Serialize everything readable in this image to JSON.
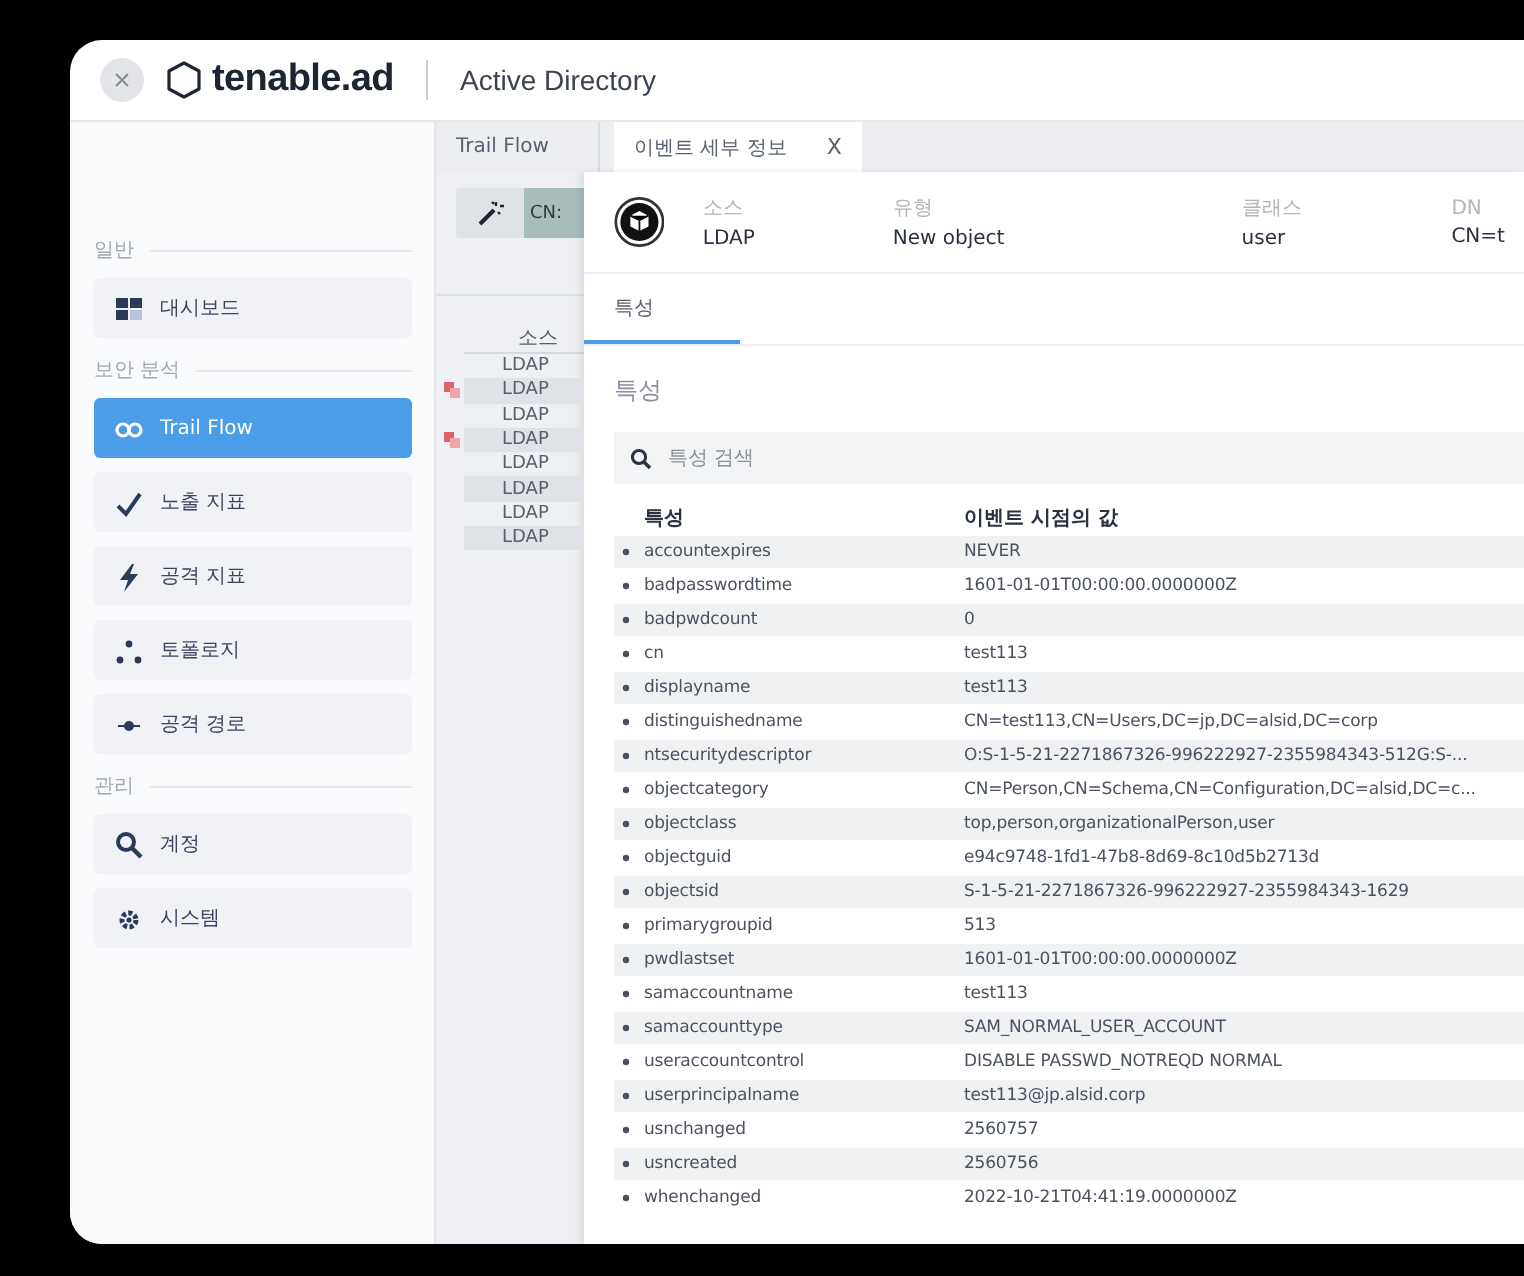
{
  "header": {
    "close_label": "×",
    "logo": "tenable.ad",
    "product": "Active Directory"
  },
  "sidebar": {
    "sections": [
      {
        "label": "일반",
        "items": [
          {
            "label": "대시보드",
            "kind": "dashboard",
            "selected": false
          }
        ]
      },
      {
        "label": "보안 분석",
        "items": [
          {
            "label": "Trail Flow",
            "kind": "flow",
            "selected": true
          },
          {
            "label": "노출 지표",
            "kind": "check",
            "selected": false
          },
          {
            "label": "공격 지표",
            "kind": "bolt",
            "selected": false
          },
          {
            "label": "토폴로지",
            "kind": "topology",
            "selected": false
          },
          {
            "label": "공격 경로",
            "kind": "path",
            "selected": false
          }
        ]
      },
      {
        "label": "관리",
        "items": [
          {
            "label": "계정",
            "kind": "search",
            "selected": false
          },
          {
            "label": "시스템",
            "kind": "gear",
            "selected": false
          }
        ]
      }
    ]
  },
  "tabs": [
    {
      "label": "Trail Flow",
      "selected": false
    },
    {
      "label": "이벤트 세부 정보",
      "selected": true,
      "close": "X"
    }
  ],
  "trail_flow": {
    "chip": "CN:",
    "column": "소스",
    "rows": [
      {
        "source": "LDAP",
        "flagged": false
      },
      {
        "source": "LDAP",
        "flagged": true
      },
      {
        "source": "LDAP",
        "flagged": false
      },
      {
        "source": "LDAP",
        "flagged": true
      },
      {
        "source": "LDAP",
        "flagged": false
      },
      {
        "source": "LDAP",
        "flagged": false
      },
      {
        "source": "LDAP",
        "flagged": false
      },
      {
        "source": "LDAP",
        "flagged": false
      }
    ]
  },
  "event": {
    "summary": [
      {
        "label": "소스",
        "value": "LDAP"
      },
      {
        "label": "유형",
        "value": "New object"
      },
      {
        "label": "클래스",
        "value": "user"
      },
      {
        "label": "DN",
        "value": "CN=t"
      }
    ],
    "subtabs": [
      {
        "label": "특성",
        "selected": true
      }
    ],
    "heading": "특성",
    "search": {
      "placeholder": "특성 검색"
    },
    "columns": [
      "특성",
      "이벤트 시점의 값"
    ],
    "rows": [
      {
        "attribute": "accountexpires",
        "value": "NEVER"
      },
      {
        "attribute": "badpasswordtime",
        "value": "1601-01-01T00:00:00.0000000Z"
      },
      {
        "attribute": "badpwdcount",
        "value": "0"
      },
      {
        "attribute": "cn",
        "value": "test113"
      },
      {
        "attribute": "displayname",
        "value": "test113"
      },
      {
        "attribute": "distinguishedname",
        "value": "CN=test113,CN=Users,DC=jp,DC=alsid,DC=corp"
      },
      {
        "attribute": "ntsecuritydescriptor",
        "value": "O:S-1-5-21-2271867326-996222927-2355984343-512G:S-..."
      },
      {
        "attribute": "objectcategory",
        "value": "CN=Person,CN=Schema,CN=Configuration,DC=alsid,DC=c..."
      },
      {
        "attribute": "objectclass",
        "value": "top,person,organizationalPerson,user"
      },
      {
        "attribute": "objectguid",
        "value": "e94c9748-1fd1-47b8-8d69-8c10d5b2713d"
      },
      {
        "attribute": "objectsid",
        "value": "S-1-5-21-2271867326-996222927-2355984343-1629"
      },
      {
        "attribute": "primarygroupid",
        "value": "513"
      },
      {
        "attribute": "pwdlastset",
        "value": "1601-01-01T00:00:00.0000000Z"
      },
      {
        "attribute": "samaccountname",
        "value": "test113"
      },
      {
        "attribute": "samaccounttype",
        "value": "SAM_NORMAL_USER_ACCOUNT"
      },
      {
        "attribute": "useraccountcontrol",
        "value": "DISABLE PASSWD_NOTREQD NORMAL"
      },
      {
        "attribute": "userprincipalname",
        "value": "test113@jp.alsid.corp"
      },
      {
        "attribute": "usnchanged",
        "value": "2560757"
      },
      {
        "attribute": "usncreated",
        "value": "2560756"
      },
      {
        "attribute": "whenchanged",
        "value": "2022-10-21T04:41:19.0000000Z"
      }
    ]
  }
}
